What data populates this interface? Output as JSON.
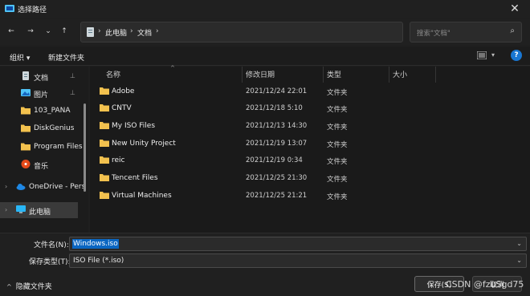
{
  "window": {
    "title": "选择路径",
    "close": "✕"
  },
  "nav": {
    "back": "←",
    "forward": "→",
    "recent": "⌄",
    "up": "↑",
    "breadcrumb": [
      "此电脑",
      "文档"
    ],
    "search_placeholder": "搜索\"文档\""
  },
  "commands": {
    "organize": "组织 ▾",
    "new_folder": "新建文件夹"
  },
  "sidebar": {
    "items": [
      {
        "label": "文档",
        "icon": "document-icon",
        "pinned": true
      },
      {
        "label": "图片",
        "icon": "picture-icon",
        "pinned": true
      },
      {
        "label": "103_PANA",
        "icon": "folder-icon"
      },
      {
        "label": "DiskGenius",
        "icon": "folder-icon"
      },
      {
        "label": "Program Files",
        "icon": "folder-icon"
      },
      {
        "label": "音乐",
        "icon": "music-icon"
      },
      {
        "label": "OneDrive - Pers",
        "icon": "cloud-icon"
      },
      {
        "label": "此电脑",
        "icon": "computer-icon"
      }
    ]
  },
  "table": {
    "columns": [
      "名称",
      "修改日期",
      "类型",
      "大小"
    ],
    "rows": [
      {
        "name": "Adobe",
        "date": "2021/12/24 22:01",
        "type": "文件夹"
      },
      {
        "name": "CNTV",
        "date": "2021/12/18 5:10",
        "type": "文件夹"
      },
      {
        "name": "My ISO Files",
        "date": "2021/12/13 14:30",
        "type": "文件夹"
      },
      {
        "name": "New Unity Project",
        "date": "2021/12/19 13:07",
        "type": "文件夹"
      },
      {
        "name": "reic",
        "date": "2021/12/19 0:34",
        "type": "文件夹"
      },
      {
        "name": "Tencent Files",
        "date": "2021/12/25 21:30",
        "type": "文件夹"
      },
      {
        "name": "Virtual Machines",
        "date": "2021/12/25 21:21",
        "type": "文件夹"
      }
    ]
  },
  "footer": {
    "filename_label": "文件名(N):",
    "filename_value": "Windows.iso",
    "filetype_label": "保存类型(T):",
    "filetype_value": "ISO File (*.iso)",
    "hide_folders": "隐藏文件夹",
    "save": "保存(S)",
    "cancel": "取消"
  },
  "watermark": "CSDN @fzuSgd75",
  "colors": {
    "accent": "#0a66c2",
    "folder": "#f2c14e",
    "bg": "#1f1f1f"
  }
}
